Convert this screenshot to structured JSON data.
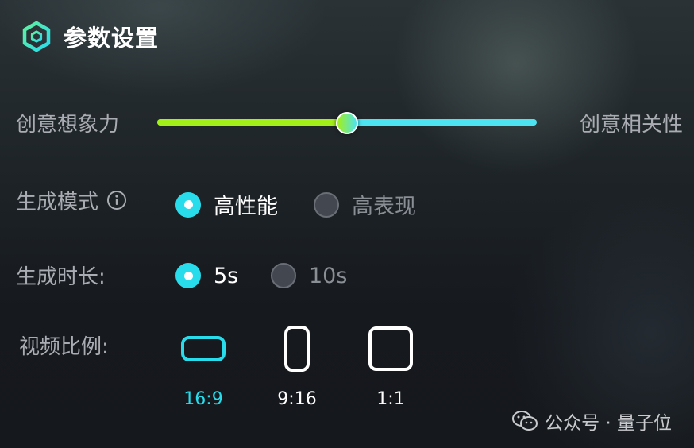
{
  "header": {
    "title": "参数设置",
    "icon": "hexagon-logo-icon",
    "accent": "#28dcec"
  },
  "slider": {
    "left_label": "创意想象力",
    "right_label": "创意相关性",
    "value": 0.5,
    "left_color": "#a3ef1a",
    "right_color": "#4ee3f0"
  },
  "mode": {
    "label": "生成模式",
    "info_icon": "info-circle-icon",
    "options": [
      "高性能",
      "高表现"
    ],
    "selected": 0
  },
  "duration": {
    "label": "生成时长:",
    "options": [
      "5s",
      "10s"
    ],
    "selected": 0
  },
  "ratio": {
    "label": "视频比例:",
    "options": [
      "16:9",
      "9:16",
      "1:1"
    ],
    "selected": 0
  },
  "watermark": {
    "icon": "wechat-icon",
    "text": "公众号 · 量子位"
  }
}
